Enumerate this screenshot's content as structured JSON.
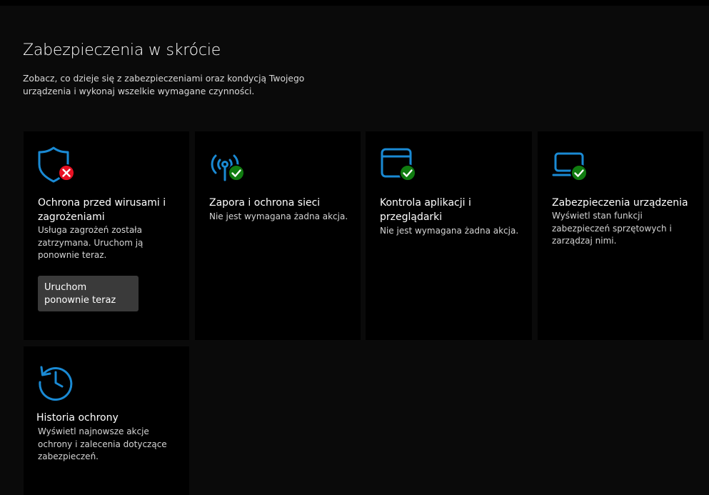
{
  "header": {
    "title": "Zabezpieczenia w skrócie",
    "subtitle": "Zobacz, co dzieje się z zabezpieczeniami oraz kondycją Twojego urządzenia i wykonaj wszelkie wymagane czynności."
  },
  "colors": {
    "accent": "#1a8ad4",
    "ok": "#107c10",
    "error": "#e81123",
    "tile_bg": "#000000",
    "button_bg": "#3a3a3a"
  },
  "tiles": [
    {
      "title": "Ochrona przed wirusami i zagrożeniami",
      "description": "Usługa zagrożeń została zatrzymana. Uruchom ją ponownie teraz.",
      "icon": "shield-icon",
      "status": "error",
      "button_label": "Uruchom ponownie teraz"
    },
    {
      "title": "Zapora i ochrona sieci",
      "description": "Nie jest wymagana żadna akcja.",
      "icon": "network-antenna-icon",
      "status": "ok"
    },
    {
      "title": "Kontrola aplikacji i przeglądarki",
      "description": "Nie jest wymagana żadna akcja.",
      "icon": "app-window-icon",
      "status": "ok"
    },
    {
      "title": "Zabezpieczenia urządzenia",
      "description": "Wyświetl stan funkcji zabezpieczeń sprzętowych i zarządzaj nimi.",
      "icon": "laptop-icon",
      "status": "ok"
    },
    {
      "title": "Historia ochrony",
      "description": "Wyświetl najnowsze akcje ochrony i zalecenia dotyczące zabezpieczeń.",
      "icon": "history-icon",
      "status": "none"
    }
  ]
}
